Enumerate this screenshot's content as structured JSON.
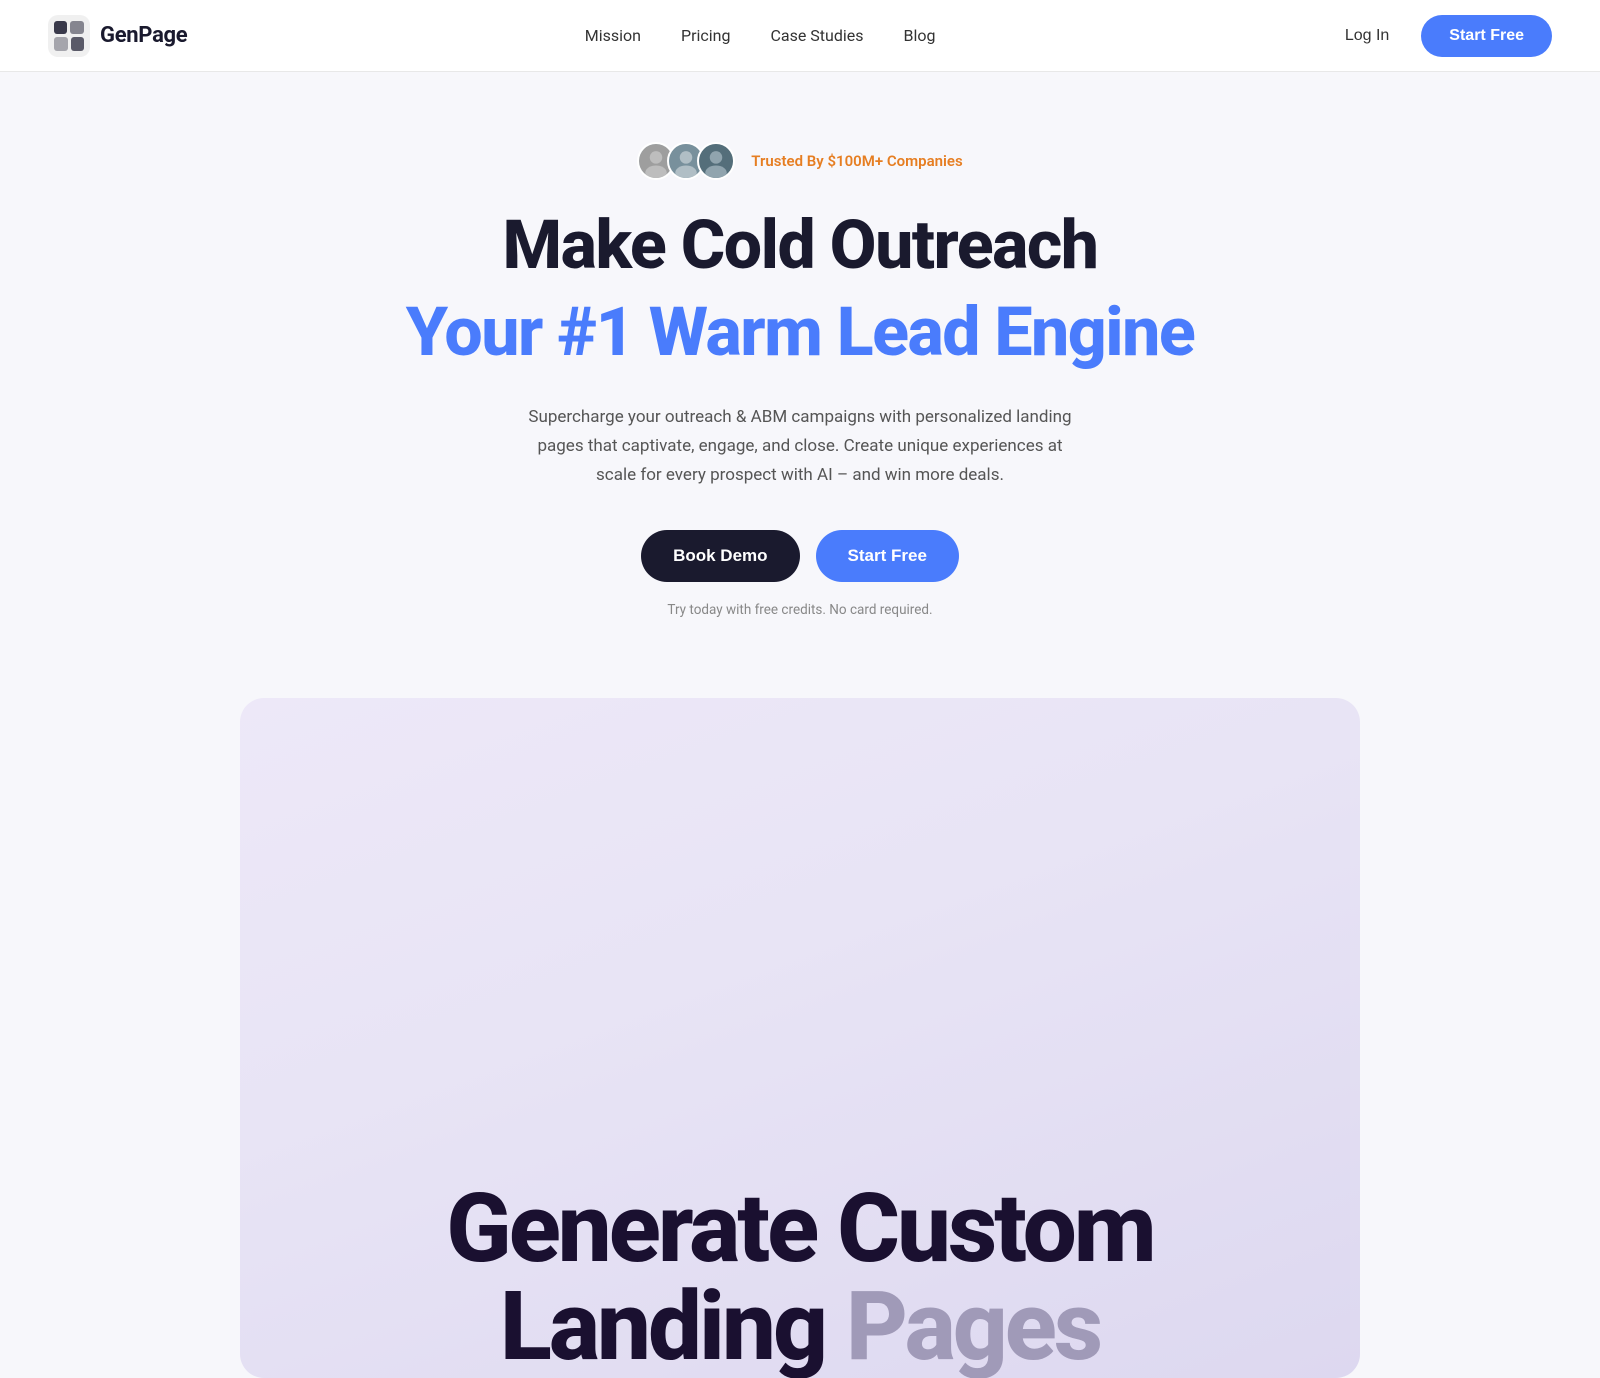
{
  "navbar": {
    "logo_text": "GenPage",
    "nav_items": [
      {
        "label": "Mission",
        "id": "mission"
      },
      {
        "label": "Pricing",
        "id": "pricing"
      },
      {
        "label": "Case Studies",
        "id": "case-studies"
      },
      {
        "label": "Blog",
        "id": "blog"
      }
    ],
    "login_label": "Log In",
    "start_free_label": "Start Free"
  },
  "hero": {
    "trusted_badge_text": "Trusted By $100M+ Companies",
    "headline_line1": "Make Cold Outreach",
    "headline_line2": "Your #1 Warm Lead Engine",
    "description": "Supercharge your outreach & ABM campaigns with personalized landing pages that captivate, engage, and close. Create unique experiences at scale for every prospect with AI – and win more deals.",
    "book_demo_label": "Book Demo",
    "start_free_label": "Start Free",
    "subtext": "Try today with free credits. No card required."
  },
  "feature_preview": {
    "title_line1": "Generate Custom",
    "title_word1": "Landing",
    "title_word2": "Pages"
  },
  "colors": {
    "blue_accent": "#4a7cfc",
    "dark_navy": "#1a1a2e",
    "orange_badge": "#e67e22",
    "purple_gradient_start": "#ede8f8",
    "purple_gradient_end": "#ddd8f0",
    "feature_text_dark": "#1a1030",
    "feature_text_muted": "#a09ab8"
  }
}
